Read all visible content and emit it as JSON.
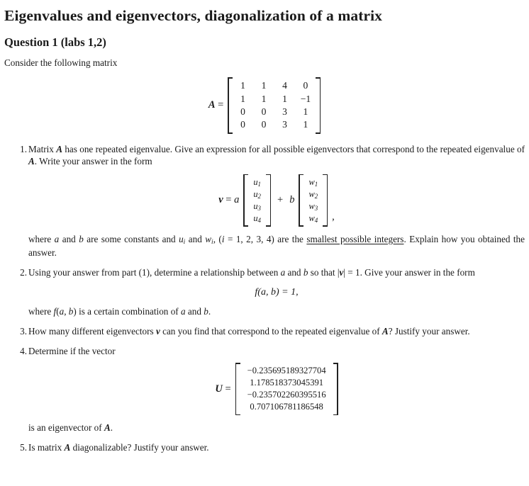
{
  "document": {
    "title": "Eigenvalues and eigenvectors, diagonalization of a matrix",
    "section_heading": "Question 1 (labs 1,2)",
    "intro": "Consider the following matrix"
  },
  "matrix_A": {
    "label": "A",
    "equals": "=",
    "rows": [
      [
        "1",
        "1",
        "4",
        "0"
      ],
      [
        "1",
        "1",
        "1",
        "−1"
      ],
      [
        "0",
        "0",
        "3",
        "1"
      ],
      [
        "0",
        "0",
        "3",
        "1"
      ]
    ]
  },
  "questions": [
    {
      "number": "1.",
      "text_parts": {
        "p1": "Matrix ",
        "var1": "A",
        "p2": " has one repeated eigenvalue. Give an expression for all possible eigenvectors that correspond to the repeated eigenvalue of ",
        "var2": "A",
        "p3": ". Write your answer in the form"
      },
      "equation": {
        "lhs_vector": "v",
        "equals": "=",
        "coeff_a": "a",
        "vector_u": [
          "u",
          "u",
          "u",
          "u"
        ],
        "vector_u_indices": [
          "1",
          "2",
          "3",
          "4"
        ],
        "plus": "+",
        "coeff_b": "b",
        "vector_w": [
          "w",
          "w",
          "w",
          "w"
        ],
        "vector_w_indices": [
          "1",
          "2",
          "3",
          "4"
        ],
        "trailing": ","
      },
      "note_parts": {
        "n1": "where ",
        "a": "a",
        "n2": " and ",
        "b": "b",
        "n3": " are some constants and ",
        "u": "u",
        "ui": "i",
        "n4": " and ",
        "w": "w",
        "wi": "i",
        "n5": ", (",
        "i": "i",
        "n6": " = 1, 2, 3, 4) are the ",
        "underlined": "smallest possible integers",
        "n7": ". Explain how you obtained the answer."
      }
    },
    {
      "number": "2.",
      "text_parts": {
        "p1": "Using your answer from part (1), determine a relationship between ",
        "var1": "a",
        "p2": " and ",
        "var2": "b",
        "p3": " so that |",
        "var3": "v",
        "p4": "| = 1. Give your answer in the form"
      },
      "equation": "f(a, b) = 1,",
      "note_parts": {
        "n1": "where ",
        "f": "f",
        "n2": "(",
        "a": "a",
        "n3": ", ",
        "b": "b",
        "n4": ") is a certain combination of ",
        "a2": "a",
        "n5": " and ",
        "b2": "b",
        "n6": "."
      }
    },
    {
      "number": "3.",
      "text_parts": {
        "p1": "How many different eigenvectors ",
        "var1": "v",
        "p2": " can you find that correspond to the repeated eigenvalue of ",
        "var2": "A",
        "p3": "? Justify your answer."
      }
    },
    {
      "number": "4.",
      "text_parts": {
        "p1": "Determine if the vector"
      },
      "vector_U": {
        "label": "U",
        "equals": "=",
        "values": [
          "−0.235695189327704",
          "1.178518373045391",
          "−0.235702260395516",
          "0.707106781186548"
        ]
      },
      "note_parts": {
        "n1": "is an eigenvector of ",
        "var": "A",
        "n2": "."
      }
    },
    {
      "number": "5.",
      "text_parts": {
        "p1": "Is matrix ",
        "var1": "A",
        "p2": " diagonalizable? Justify your answer."
      }
    }
  ]
}
